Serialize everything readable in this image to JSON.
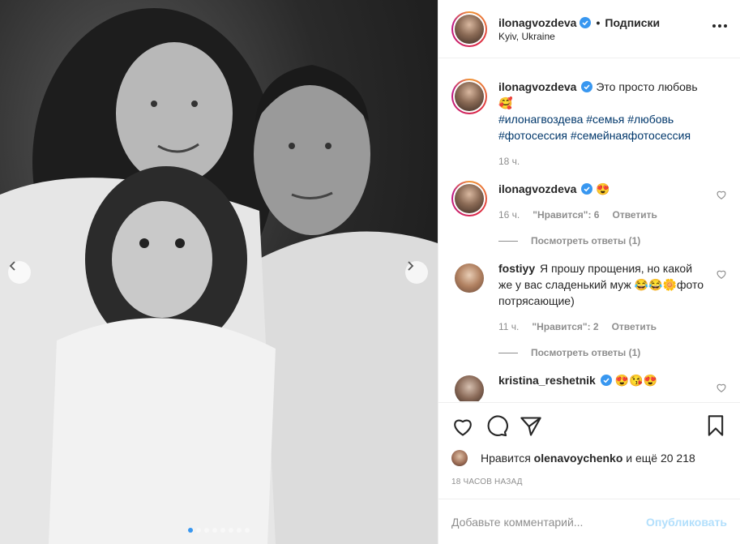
{
  "header": {
    "username": "ilonagvozdeva",
    "separator": "•",
    "follow_label": "Подписки",
    "location": "Kyiv, Ukraine"
  },
  "caption": {
    "username": "ilonagvozdeva",
    "text": "Это просто любовь",
    "emoji": "🥰",
    "hashtags": "#илонагвоздева #семья #любовь #фотосессия #семейнаяфотосессия",
    "time": "18 ч."
  },
  "comments": [
    {
      "username": "ilonagvozdeva",
      "text": "😍",
      "time": "16 ч.",
      "likes_label": "\"Нравится\": 6",
      "reply_label": "Ответить",
      "view_replies": "Посмотреть ответы (1)"
    },
    {
      "username": "fostiyy",
      "text": "Я прошу прощения, но какой же у вас сладенький муж 😂😂🌼фото потрясающие)",
      "time": "11 ч.",
      "likes_label": "\"Нравится\": 2",
      "reply_label": "Ответить",
      "view_replies": "Посмотреть ответы (1)"
    },
    {
      "username": "kristina_reshetnik",
      "text": "😍😘😍"
    }
  ],
  "likes": {
    "prefix": "Нравится",
    "user": "olenavoychenko",
    "suffix": "и ещё 20 218"
  },
  "post_time": "18 часов назад",
  "comment_box": {
    "placeholder": "Добавьте комментарий...",
    "publish_label": "Опубликовать"
  },
  "carousel": {
    "total": 8,
    "active_index": 0
  },
  "colors": {
    "verified_blue": "#3897f0",
    "hashtag": "#00376b",
    "muted": "#8e8e8e",
    "publish_disabled": "#b2dffc"
  },
  "icons": [
    "heart-icon",
    "comment-icon",
    "share-icon",
    "bookmark-icon",
    "more-icon",
    "chevron-left-icon",
    "chevron-right-icon",
    "verified-icon"
  ]
}
